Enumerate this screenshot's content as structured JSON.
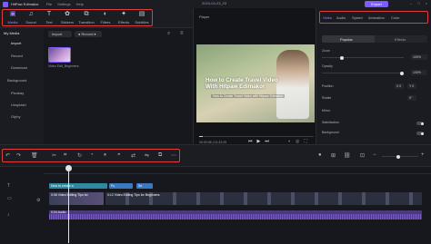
{
  "titlebar": {
    "app_name": "HitPaw Edimakor",
    "menus": [
      "File",
      "Settings",
      "Help"
    ],
    "project": "2024-04-23_03",
    "export_label": "Export"
  },
  "tabs": [
    {
      "label": "Media",
      "icon": "media-icon"
    },
    {
      "label": "Sound",
      "icon": "sound-icon"
    },
    {
      "label": "Text",
      "icon": "text-icon"
    },
    {
      "label": "Stickers",
      "icon": "stickers-icon"
    },
    {
      "label": "Transition",
      "icon": "transition-icon"
    },
    {
      "label": "Filters",
      "icon": "filters-icon"
    },
    {
      "label": "Effects",
      "icon": "effects-icon"
    },
    {
      "label": "Subtitles",
      "icon": "subtitles-icon"
    }
  ],
  "sidebar": {
    "items": [
      "My Media",
      "Import",
      "Record",
      "Download",
      "Background",
      "Pixabay",
      "Unsplash",
      "Giphy"
    ]
  },
  "media": {
    "import_label": "Import",
    "record_label": "Record",
    "thumb_name": "Video Edit_Beginners"
  },
  "player": {
    "title": "Player",
    "video_title": "How to Create Travel Video With Hitpaw Edimakor",
    "video_sub": "How to Create Travel Video with Hitpaw Edimakor",
    "timecode": "00:00:06 | 01:22:29",
    "progress_fraction": 0.03
  },
  "props": {
    "tabs": [
      "Video",
      "Audio",
      "Speed",
      "Animation",
      "Color"
    ],
    "segment": [
      "Popular",
      "Effects"
    ],
    "zoom_label": "Zoom",
    "zoom_value": "100%",
    "opacity_label": "Opacity",
    "opacity_value": "100%",
    "position_label": "Position",
    "pos_x": "X 0",
    "pos_y": "Y 0",
    "rotate_label": "Rotate",
    "rotate_value": "0°",
    "mirror_label": "Mirror",
    "stab_label": "Stabilization",
    "bg_label": "Background",
    "reset_label": "Reset"
  },
  "timeline": {
    "text_clip_1": "How to create a",
    "text_clip_2": "Fu",
    "text_clip_3": "Se",
    "video_clip_1": "0:06 Video Editing Tips for",
    "video_clip_2": "0:12 Video Editing Tips for Beginners",
    "audio_clip": "0:04 Audio"
  }
}
